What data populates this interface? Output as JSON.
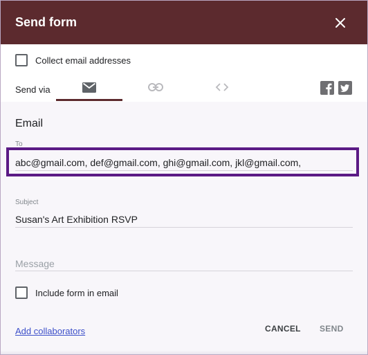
{
  "dialog": {
    "title": "Send form",
    "collect_email_label": "Collect email addresses",
    "send_via_label": "Send via",
    "tabs": [
      {
        "name": "email",
        "icon": "mail-icon",
        "active": true
      },
      {
        "name": "link",
        "icon": "link-icon",
        "active": false
      },
      {
        "name": "embed",
        "icon": "code-icon",
        "active": false
      }
    ],
    "social": [
      "facebook-icon",
      "twitter-icon"
    ],
    "section_title": "Email",
    "to": {
      "label": "To",
      "value": "abc@gmail.com, def@gmail.com, ghi@gmail.com, jkl@gmail.com,"
    },
    "subject": {
      "label": "Subject",
      "value": "Susan's Art Exhibition RSVP"
    },
    "message": {
      "placeholder": "Message"
    },
    "include_form_label": "Include form in email",
    "add_collaborators": "Add collaborators",
    "cancel_label": "CANCEL",
    "send_label": "SEND"
  },
  "colors": {
    "header": "#5c2a2e",
    "highlight": "#5b1a85",
    "link": "#3c4fc9"
  }
}
